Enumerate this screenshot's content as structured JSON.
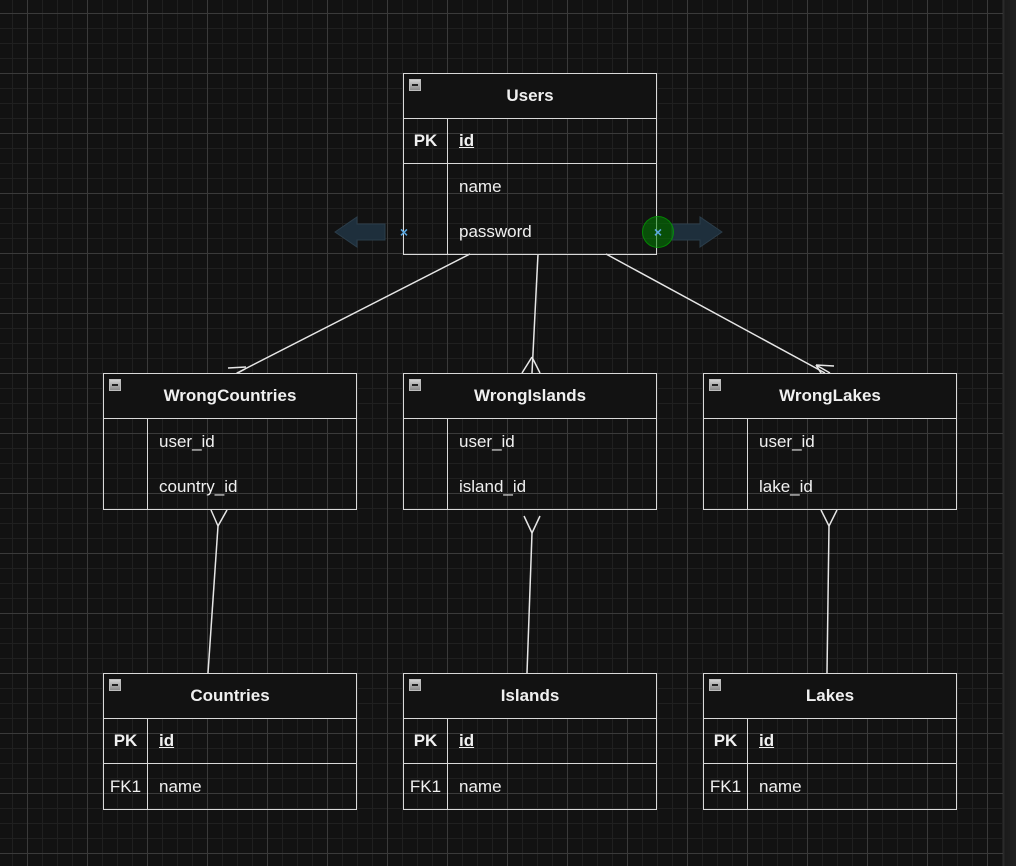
{
  "diagram": {
    "type": "entity-relationship",
    "tables": [
      {
        "id": "users",
        "title": "Users",
        "pk_rows": [
          {
            "key": "PK",
            "field": "id"
          }
        ],
        "rows": [
          {
            "key": "",
            "field": "name"
          },
          {
            "key": "",
            "field": "password"
          }
        ]
      },
      {
        "id": "wrong_countries",
        "title": "WrongCountries",
        "pk_rows": [],
        "rows": [
          {
            "key": "",
            "field": "user_id"
          },
          {
            "key": "",
            "field": "country_id"
          }
        ]
      },
      {
        "id": "wrong_islands",
        "title": "WrongIslands",
        "pk_rows": [],
        "rows": [
          {
            "key": "",
            "field": "user_id"
          },
          {
            "key": "",
            "field": "island_id"
          }
        ]
      },
      {
        "id": "wrong_lakes",
        "title": "WrongLakes",
        "pk_rows": [],
        "rows": [
          {
            "key": "",
            "field": "user_id"
          },
          {
            "key": "",
            "field": "lake_id"
          }
        ]
      },
      {
        "id": "countries",
        "title": "Countries",
        "pk_rows": [
          {
            "key": "PK",
            "field": "id"
          }
        ],
        "rows": [
          {
            "key": "FK1",
            "field": "name"
          }
        ]
      },
      {
        "id": "islands",
        "title": "Islands",
        "pk_rows": [
          {
            "key": "PK",
            "field": "id"
          }
        ],
        "rows": [
          {
            "key": "FK1",
            "field": "name"
          }
        ]
      },
      {
        "id": "lakes",
        "title": "Lakes",
        "pk_rows": [
          {
            "key": "PK",
            "field": "id"
          }
        ],
        "rows": [
          {
            "key": "FK1",
            "field": "name"
          }
        ]
      }
    ],
    "relationships": [
      {
        "from": "Users",
        "to": "WrongCountries",
        "to_end": "crows-foot-many"
      },
      {
        "from": "Users",
        "to": "WrongIslands",
        "to_end": "crows-foot-many"
      },
      {
        "from": "Users",
        "to": "WrongLakes",
        "to_end": "crows-foot-many"
      },
      {
        "from": "Countries",
        "to": "WrongCountries",
        "to_end": "crows-foot-many"
      },
      {
        "from": "Islands",
        "to": "WrongIslands",
        "to_end": "crows-foot-many"
      },
      {
        "from": "Lakes",
        "to": "WrongLakes",
        "to_end": "crows-foot-many"
      }
    ],
    "selection_hints": {
      "left_arrow_icon": "arrow-left-icon",
      "right_arrow_icon": "arrow-right-icon",
      "connection_point_icon": "x-connection-icon",
      "active_connection_color": "#0a8a0a",
      "connection_point_color": "#5aa7e0"
    }
  },
  "colors": {
    "canvas_bg": "#121212",
    "stroke": "#d9d9d9",
    "text": "#f0f0f0"
  }
}
